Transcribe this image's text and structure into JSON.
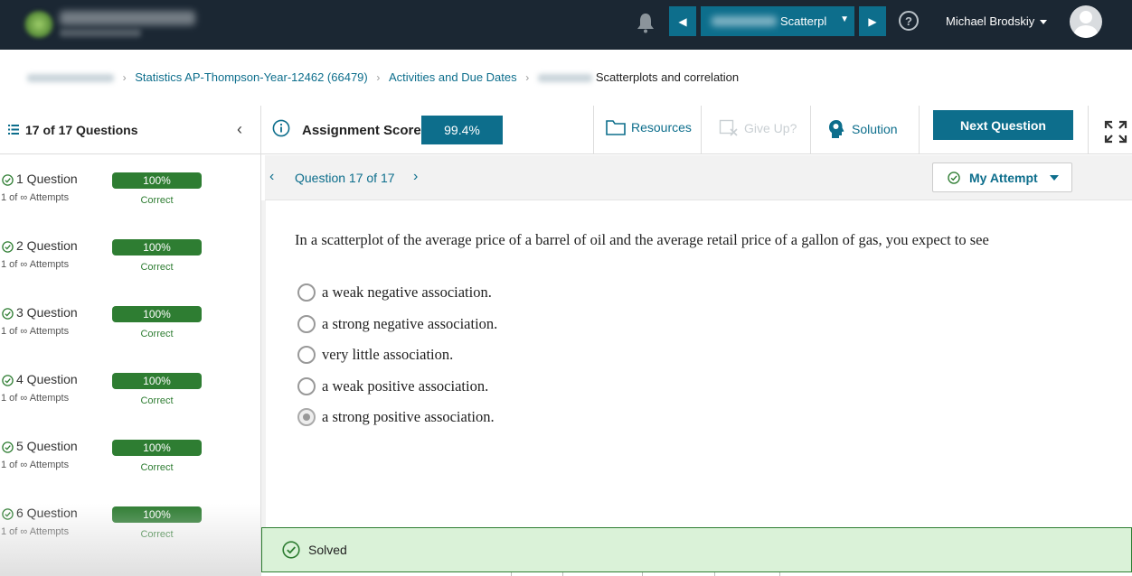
{
  "header": {
    "logo_text": "Hawkes Learning",
    "assignment_select_visible": "Scatterpl",
    "user_name": "Michael Brodskiy"
  },
  "breadcrumb": {
    "course": "Statistics AP-Thompson-Year-12462 (66479)",
    "activities": "Activities and Due Dates",
    "current": "Scatterplots and correlation"
  },
  "sidebar": {
    "title": "17 of 17 Questions",
    "questions": [
      {
        "label": "1 Question",
        "attempts": "1 of ∞ Attempts",
        "score": "100%",
        "status": "Correct",
        "progress": 1.0
      },
      {
        "label": "2 Question",
        "attempts": "1 of ∞ Attempts",
        "score": "100%",
        "status": "Correct",
        "progress": 1.0
      },
      {
        "label": "3 Question",
        "attempts": "1 of ∞ Attempts",
        "score": "100%",
        "status": "Correct",
        "progress": 1.0
      },
      {
        "label": "4 Question",
        "attempts": "1 of ∞ Attempts",
        "score": "100%",
        "status": "Correct",
        "progress": 1.0
      },
      {
        "label": "5 Question",
        "attempts": "1 of ∞ Attempts",
        "score": "100%",
        "status": "Correct",
        "progress": 1.0
      },
      {
        "label": "6 Question",
        "attempts": "1 of ∞ Attempts",
        "score": "100%",
        "status": "Correct",
        "progress": 1.0
      }
    ]
  },
  "toolbar": {
    "score_label": "Assignment Score:",
    "score_value": "99.4%",
    "resources": "Resources",
    "give_up": "Give Up?",
    "solution": "Solution",
    "next_question": "Next Question"
  },
  "question_nav": {
    "label": "Question 17 of 17",
    "attempt_label": "My Attempt"
  },
  "question": {
    "text": "In a scatterplot of the average price of a barrel of oil and the average retail price of a gallon of gas, you expect to see",
    "choices": [
      {
        "text": "a weak negative association.",
        "selected": false
      },
      {
        "text": "a strong negative association.",
        "selected": false
      },
      {
        "text": "very little association.",
        "selected": false
      },
      {
        "text": "a weak positive association.",
        "selected": false
      },
      {
        "text": "a strong positive association.",
        "selected": true
      }
    ]
  },
  "status_banner": {
    "text": "Solved"
  },
  "colors": {
    "topbar": "#1b2733",
    "accent": "#0d6e8c",
    "success": "#2e7d32",
    "success_bg": "#daf2d8"
  }
}
